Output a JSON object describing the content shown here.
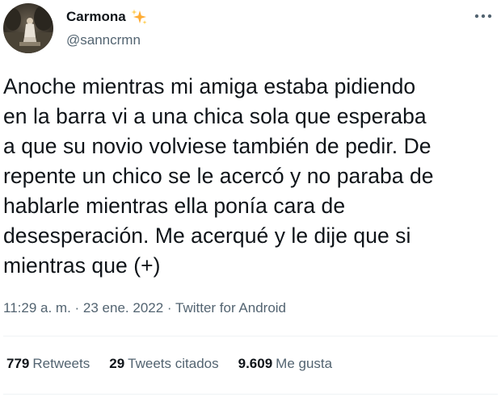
{
  "author": {
    "display_name": "Carmona",
    "handle": "@sanncrmn",
    "name_emoji_icon": "sparkles-icon"
  },
  "menu_icon": "more-horizontal-icon",
  "tweet": {
    "text": "Anoche mientras mi amiga estaba pidiendo\nen la barra vi a una chica sola que esperaba\na que su novio volviese también de pedir. De\nrepente un chico se le acercó y no paraba de\nhablarle mientras ella ponía cara de\ndesesperación. Me acerqué y le dije que si\nmientras que (+)"
  },
  "meta": {
    "time": "11:29 a. m.",
    "separator": "·",
    "date": "23 ene. 2022",
    "source": "Twitter for Android"
  },
  "stats": {
    "retweets": {
      "count": "779",
      "label": "Retweets"
    },
    "quotes": {
      "count": "29",
      "label": "Tweets citados"
    },
    "likes": {
      "count": "9.609",
      "label": "Me gusta"
    }
  },
  "colors": {
    "text_primary": "#0f1419",
    "text_secondary": "#536471",
    "divider": "#eff3f4",
    "sparkle": "#ffac33"
  }
}
